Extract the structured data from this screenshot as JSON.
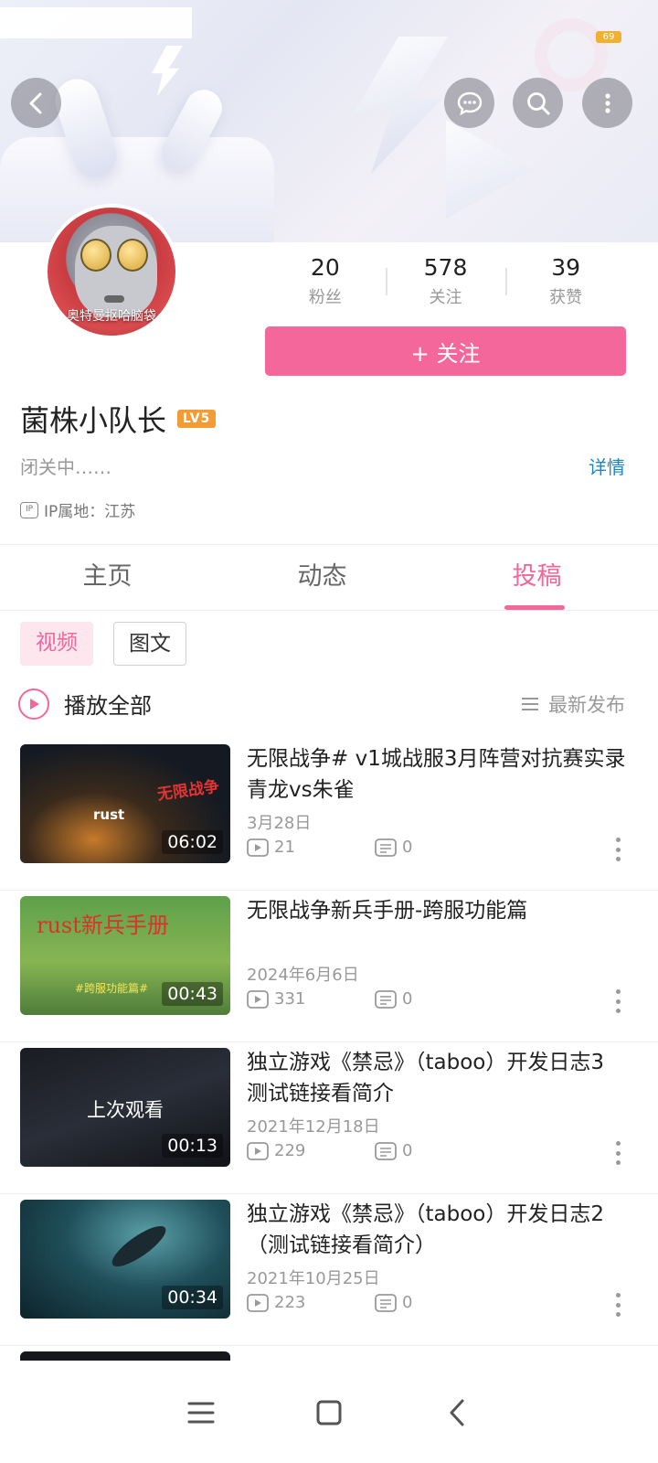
{
  "status_bar": {
    "battery": "69"
  },
  "banner": {},
  "profile": {
    "avatar_caption": "奥特曼抠哈脑袋",
    "stats": [
      {
        "value": "20",
        "label": "粉丝"
      },
      {
        "value": "578",
        "label": "关注"
      },
      {
        "value": "39",
        "label": "获赞"
      }
    ],
    "follow_label": "+ 关注",
    "name": "菌株小队长",
    "level": "LV5",
    "bio": "闭关中……",
    "detail_link": "详情",
    "ip_icon_text": "IP",
    "ip_location": "IP属地：江苏"
  },
  "tabs": [
    {
      "label": "主页",
      "active": false
    },
    {
      "label": "动态",
      "active": false
    },
    {
      "label": "投稿",
      "active": true
    }
  ],
  "filters": {
    "video": "视频",
    "text": "图文"
  },
  "list_header": {
    "play_all": "播放全部",
    "sort": "最新发布"
  },
  "videos": [
    {
      "title": "无限战争# v1城战服3月阵营对抗赛实录 青龙vs朱雀",
      "date": "3月28日",
      "duration": "06:02",
      "plays": "21",
      "comments": "0",
      "thumb_tag": "无限战争",
      "thumb_text": "rust"
    },
    {
      "title": "无限战争新兵手册-跨服功能篇",
      "date": "2024年6月6日",
      "duration": "00:43",
      "plays": "331",
      "comments": "0",
      "thumb_tag": "rust新兵手册",
      "thumb_text": "#跨服功能篇#"
    },
    {
      "title": "独立游戏《禁忌》（taboo）开发日志3 测试链接看简介",
      "date": "2021年12月18日",
      "duration": "00:13",
      "plays": "229",
      "comments": "0",
      "thumb_overlay": "上次观看"
    },
    {
      "title": "独立游戏《禁忌》（taboo）开发日志2（测试链接看简介）",
      "date": "2021年10月25日",
      "duration": "00:34",
      "plays": "223",
      "comments": "0"
    }
  ],
  "colors": {
    "accent": "#f4679a",
    "link": "#1c86c6",
    "level_badge": "#f39b34"
  }
}
